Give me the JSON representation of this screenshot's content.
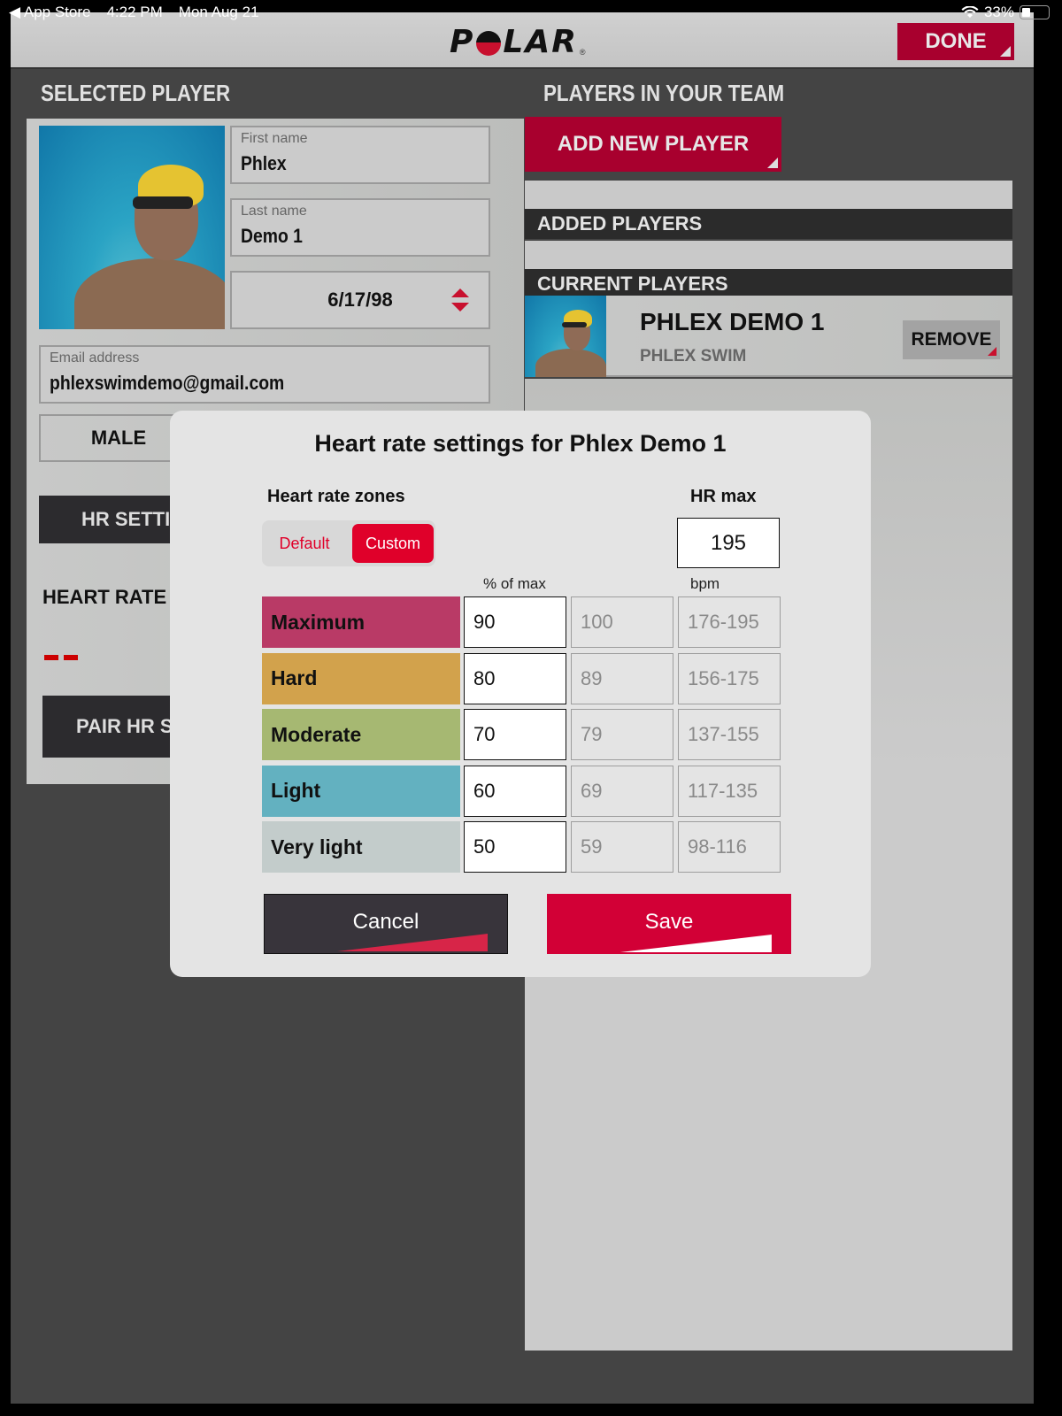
{
  "status_bar": {
    "back_app": "App Store",
    "time": "4:22 PM",
    "date": "Mon Aug 21",
    "battery": "33%",
    "battery_level": 0.33
  },
  "topbar": {
    "logo": "POLAR",
    "done_label": "DONE"
  },
  "selected_player": {
    "section_title": "SELECTED PLAYER",
    "first_name": {
      "label": "First name",
      "value": "Phlex"
    },
    "last_name": {
      "label": "Last name",
      "value": "Demo 1"
    },
    "birthdate": "6/17/98",
    "email": {
      "label": "Email address",
      "value": "phlexswimdemo@gmail.com"
    },
    "gender": "MALE",
    "hr_settings_label": "HR SETTINGS",
    "hr_sensor_title": "HEART RATE SENSOR",
    "hr_sensor_value": "--",
    "pair_sensor_label": "PAIR HR SENSOR"
  },
  "team": {
    "section_title": "PLAYERS IN YOUR TEAM",
    "add_player_label": "ADD NEW PLAYER",
    "added_players_header": "ADDED PLAYERS",
    "current_players_header": "CURRENT PLAYERS",
    "players": [
      {
        "name": "PHLEX DEMO 1",
        "team": "PHLEX SWIM",
        "remove_label": "REMOVE"
      }
    ]
  },
  "modal": {
    "title": "Heart rate settings for Phlex Demo 1",
    "zones_label": "Heart rate zones",
    "mode_options": [
      "Default",
      "Custom"
    ],
    "selected_mode": "Custom",
    "hr_max_label": "HR max",
    "hr_max_value": "195",
    "pct_header": "% of max",
    "bpm_header": "bpm",
    "zones": [
      {
        "name": "Maximum",
        "lower_pct": "90",
        "upper_pct": "100",
        "bpm": "176-195",
        "color": "#b93a66"
      },
      {
        "name": "Hard",
        "lower_pct": "80",
        "upper_pct": "89",
        "bpm": "156-175",
        "color": "#d2a24c"
      },
      {
        "name": "Moderate",
        "lower_pct": "70",
        "upper_pct": "79",
        "bpm": "137-155",
        "color": "#a6b872"
      },
      {
        "name": "Light",
        "lower_pct": "60",
        "upper_pct": "69",
        "bpm": "117-135",
        "color": "#63b1c0"
      },
      {
        "name": "Very light",
        "lower_pct": "50",
        "upper_pct": "59",
        "bpm": "98-116",
        "color": "#c3cccb"
      }
    ],
    "cancel_label": "Cancel",
    "save_label": "Save"
  }
}
